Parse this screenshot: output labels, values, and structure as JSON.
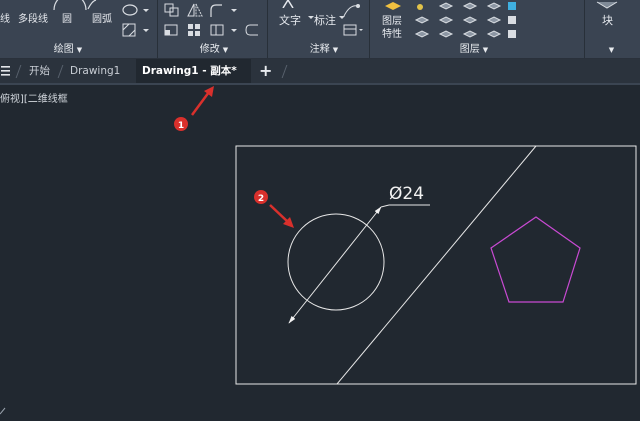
{
  "ribbon": {
    "draw_tools": {
      "line_label": "线",
      "polyline_label": "多段线",
      "circle_label": "圆",
      "arc_label": "圆弧"
    },
    "annotate_tools": {
      "text_label": "文字",
      "dimension_label": "标注"
    },
    "layer_tools": {
      "layer_props_line1": "图层",
      "layer_props_line2": "特性"
    },
    "block_tools": {
      "block_label": "块"
    },
    "panels": {
      "draw": "绘图",
      "modify": "修改",
      "annotate": "注释",
      "layers": "图层"
    }
  },
  "tabs": {
    "menu_icon": "menu-icon",
    "start": "开始",
    "drawing1": "Drawing1",
    "active": "Drawing1 - 副本*",
    "new_tab": "+"
  },
  "viewport": {
    "view_label": "俯视][二维线框",
    "dimension_text": "Ø24",
    "callout_1": "1",
    "callout_2": "2",
    "colors": {
      "geometry": "#e8e8e8",
      "polygon": "#c94ad3",
      "callout": "#d9302c",
      "background": "#212830"
    }
  }
}
